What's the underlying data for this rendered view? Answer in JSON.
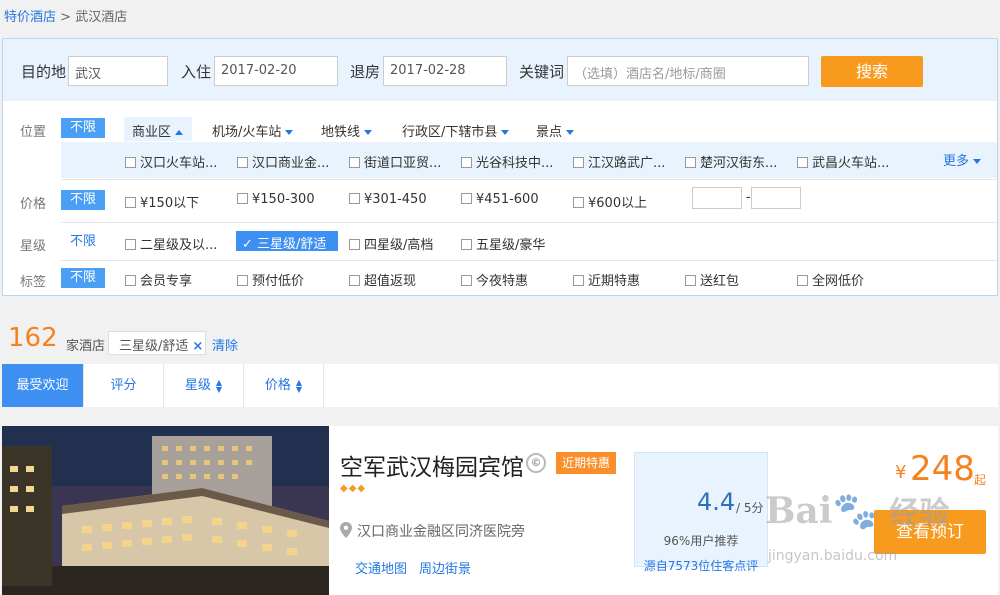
{
  "breadcrumb": {
    "link": "特价酒店",
    "separator": ">",
    "current": "武汉酒店"
  },
  "search": {
    "destination_label": "目的地",
    "destination_value": "武汉",
    "checkin_label": "入住",
    "checkin_value": "2017-02-20",
    "checkout_label": "退房",
    "checkout_value": "2017-02-28",
    "keyword_label": "关键词",
    "keyword_placeholder": "（选填）酒店名/地标/商圈",
    "search_button": "搜索"
  },
  "filters": {
    "no_limit": "不限",
    "location": {
      "label": "位置",
      "tabs": [
        "商业区",
        "机场/火车站",
        "地铁线",
        "行政区/下辖市县",
        "景点"
      ],
      "options": [
        "汉口火车站...",
        "汉口商业金...",
        "街道口亚贸...",
        "光谷科技中...",
        "江汉路武广...",
        "楚河汉街东...",
        "武昌火车站..."
      ],
      "more": "更多"
    },
    "price": {
      "label": "价格",
      "options": [
        "¥150以下",
        "¥150-300",
        "¥301-450",
        "¥451-600",
        "¥600以上"
      ],
      "range_sep": "-"
    },
    "star": {
      "label": "星级",
      "options": [
        "二星级及以...",
        "三星级/舒适",
        "四星级/高档",
        "五星级/豪华"
      ],
      "selected": "三星级/舒适"
    },
    "tags": {
      "label": "标签",
      "options": [
        "会员专享",
        "预付低价",
        "超值返现",
        "今夜特惠",
        "近期特惠",
        "送红包",
        "全网低价"
      ]
    }
  },
  "results": {
    "count": "162",
    "count_unit": "家酒店",
    "chip_label": "三星级/舒适",
    "chip_close": "×",
    "clear": "清除"
  },
  "sort": {
    "tabs": [
      "最受欢迎",
      "评分",
      "星级",
      "价格"
    ]
  },
  "hotel": {
    "name": "空军武汉梅园宾馆",
    "badge": "近期特惠",
    "rating_diamonds": "◆◆◆",
    "address": "汉口商业金融区同济医院旁",
    "links": [
      "交通地图",
      "周边街景"
    ],
    "score": "4.4",
    "score_of": "/ 5分",
    "recommend": "96%用户推荐",
    "reviews": "源自7573位住客点评",
    "price_symbol": "¥",
    "price": "248",
    "price_suffix": "起",
    "book_button": "查看预订"
  },
  "watermark": {
    "logo": "Bai",
    "text": "经验",
    "url": "jingyan.baidu.com"
  },
  "colors": {
    "accent": "#2577e3",
    "orange": "#f79a1e",
    "panel_bg": "#e8f3fd",
    "selected": "#3d8ff2"
  }
}
